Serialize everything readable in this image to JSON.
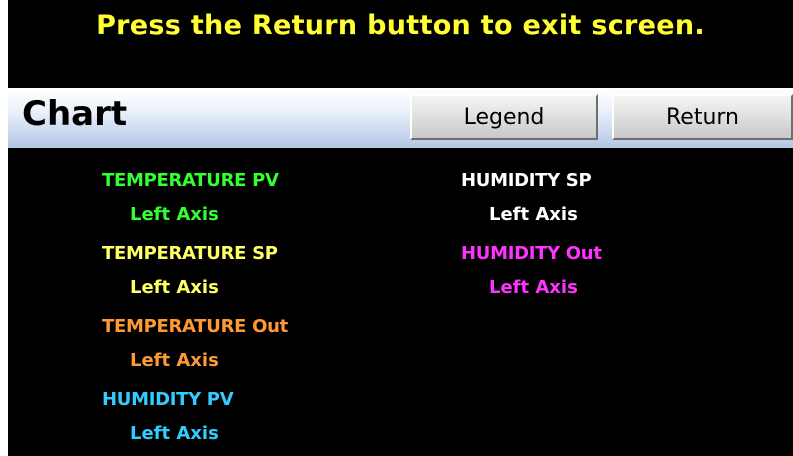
{
  "banner": {
    "message": "Press the Return button to exit screen."
  },
  "header": {
    "title": "Chart",
    "legend_button_label": "Legend",
    "return_button_label": "Return"
  },
  "legend": {
    "left_column": [
      {
        "name": "TEMPERATURE PV",
        "axis": "Left Axis",
        "color": "#33ff33"
      },
      {
        "name": "TEMPERATURE SP",
        "axis": "Left Axis",
        "color": "#ffff66"
      },
      {
        "name": "TEMPERATURE Out",
        "axis": "Left Axis",
        "color": "#ff9933"
      },
      {
        "name": "HUMIDITY PV",
        "axis": "Left Axis",
        "color": "#33ccff"
      }
    ],
    "right_column": [
      {
        "name": "HUMIDITY SP",
        "axis": "Left Axis",
        "color": "#ffffff"
      },
      {
        "name": "HUMIDITY Out",
        "axis": "Left Axis",
        "color": "#ff33ff"
      }
    ]
  },
  "colors": {
    "banner_text": "#ffff33",
    "background": "#000000",
    "header_gradient_end": "#b3c6e6"
  }
}
